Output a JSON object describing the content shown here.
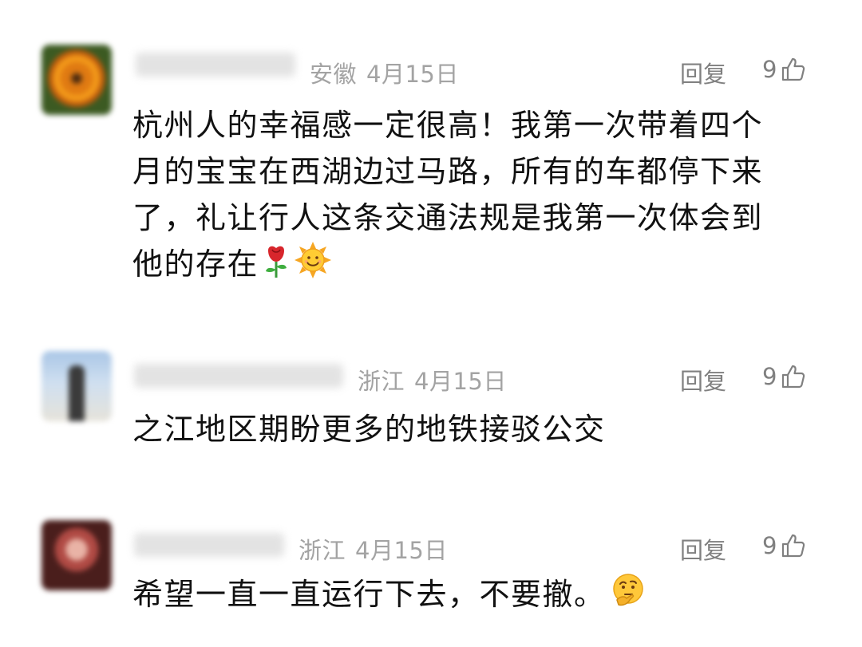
{
  "comments": [
    {
      "location": "安徽",
      "date": "4月15日",
      "reply_label": "回复",
      "likes": "9",
      "lines": [
        "杭州人的幸福感一定很高！我第一次带着四个",
        "月的宝宝在西湖边过马路，所有的车都停下来",
        "了，礼让行人这条交通法规是我第一次体会到",
        "他的存在"
      ],
      "emojis": [
        "rose-icon",
        "sun-smile-icon"
      ]
    },
    {
      "location": "浙江",
      "date": "4月15日",
      "reply_label": "回复",
      "likes": "9",
      "lines": [
        "之江地区期盼更多的地铁接驳公交"
      ]
    },
    {
      "location": "浙江",
      "date": "4月15日",
      "reply_label": "回复",
      "likes": "9",
      "lines": [
        "希望一直一直运行下去，不要撤。"
      ],
      "emojis": [
        "thinking-face-icon"
      ]
    }
  ],
  "colors": {
    "meta_text": "#a3a3a3",
    "action_text": "#808080",
    "body_text": "#111111"
  }
}
